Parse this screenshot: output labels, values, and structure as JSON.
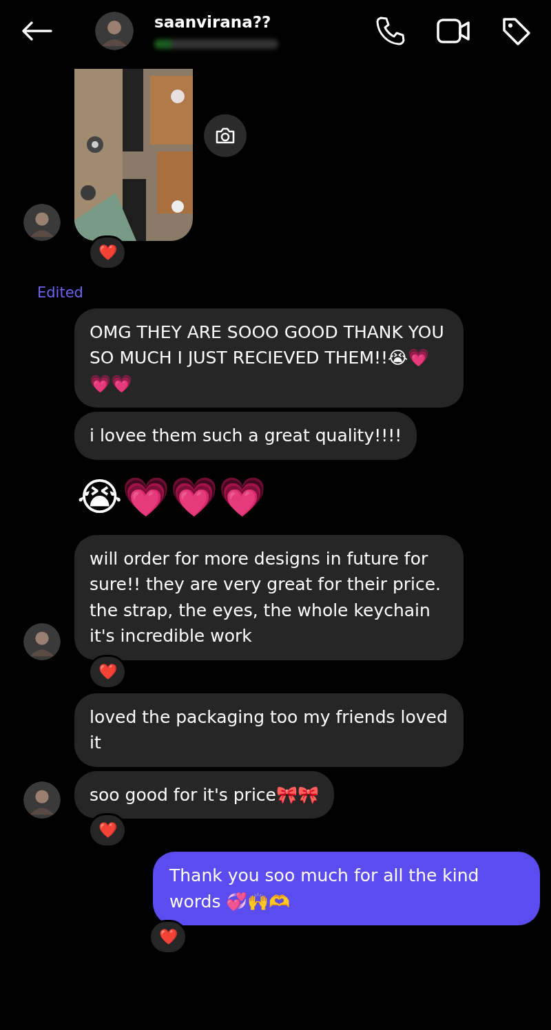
{
  "header": {
    "title": "saanvirana??",
    "status_blurred": true
  },
  "messages": [
    {
      "outgoing": false,
      "avatar": true,
      "reaction": "❤️"
    },
    {
      "kind": "text",
      "outgoing": false,
      "avatar": false,
      "label": "Edited",
      "text": "OMG THEY ARE SOOO GOOD THANK YOU SO MUCH I JUST RECIEVED THEM!!😭💗💗💗"
    },
    {
      "kind": "text",
      "outgoing": false,
      "avatar": false,
      "text": "i lovee them such a great quality!!!!"
    },
    {
      "kind": "emoji",
      "outgoing": false,
      "avatar": false,
      "text": "😭💗💗💗"
    },
    {
      "kind": "text",
      "outgoing": false,
      "avatar": true,
      "reaction": "❤️",
      "text": "will order for more designs in future for sure!! they are very great for their price. the strap, the eyes, the whole keychain it's incredible work"
    },
    {
      "kind": "text",
      "outgoing": false,
      "avatar": false,
      "text": "loved the packaging too my friends loved it"
    },
    {
      "kind": "text",
      "outgoing": false,
      "avatar": true,
      "reaction": "❤️",
      "text": "soo good for it's price🎀🎀"
    },
    {
      "kind": "text",
      "outgoing": true,
      "avatar": false,
      "reaction": "❤️",
      "text": "Thank you soo much for all the kind words 💞🙌🫶"
    }
  ]
}
